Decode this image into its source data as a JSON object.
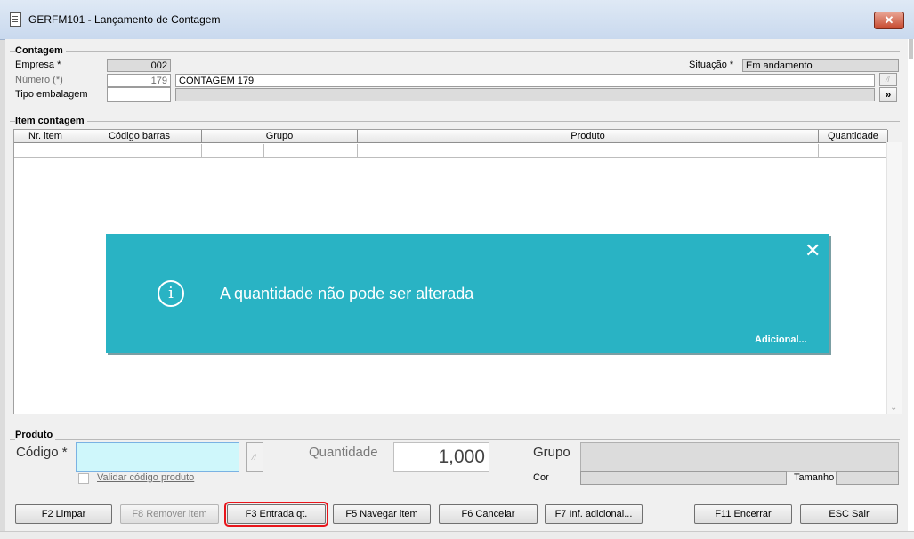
{
  "window": {
    "title": "GERFM101 - Lançamento de Contagem",
    "close_label": "✕"
  },
  "contagem": {
    "group_title": "Contagem",
    "empresa_label": "Empresa *",
    "empresa_value": "002",
    "numero_label": "Número (*)",
    "numero_value": "179",
    "numero_desc": "CONTAGEM 179",
    "tipo_embalagem_label": "Tipo embalagem",
    "tipo_embalagem_value": "",
    "situacao_label": "Situação *",
    "situacao_value": "Em andamento",
    "expand_label": "»"
  },
  "item_contagem": {
    "group_title": "Item contagem",
    "columns": [
      "Nr. item",
      "Código barras",
      "Grupo",
      "Produto",
      "Quantidade"
    ]
  },
  "toast": {
    "icon": "info-icon",
    "message": "A quantidade não pode ser alterada",
    "more_label": "Adicional...",
    "close_label": "✕"
  },
  "produto": {
    "group_title": "Produto",
    "codigo_label": "Código *",
    "codigo_value": "",
    "validar_label": "Validar código produto",
    "quantidade_label": "Quantidade",
    "quantidade_value": "1,000",
    "grupo_label": "Grupo",
    "cor_label": "Cor",
    "tamanho_label": "Tamanho"
  },
  "buttons": {
    "limpar": "F2 Limpar",
    "remover": "F8 Remover item",
    "entrada": "F3 Entrada qt.",
    "navegar": "F5 Navegar item",
    "cancelar": "F6 Cancelar",
    "inf_adicional": "F7 Inf. adicional...",
    "encerrar": "F11 Encerrar",
    "sair": "ESC Sair"
  },
  "colors": {
    "toast_bg": "#29b3c4",
    "codigo_bg": "#cff7fb",
    "focus_outline": "#e8151b"
  }
}
